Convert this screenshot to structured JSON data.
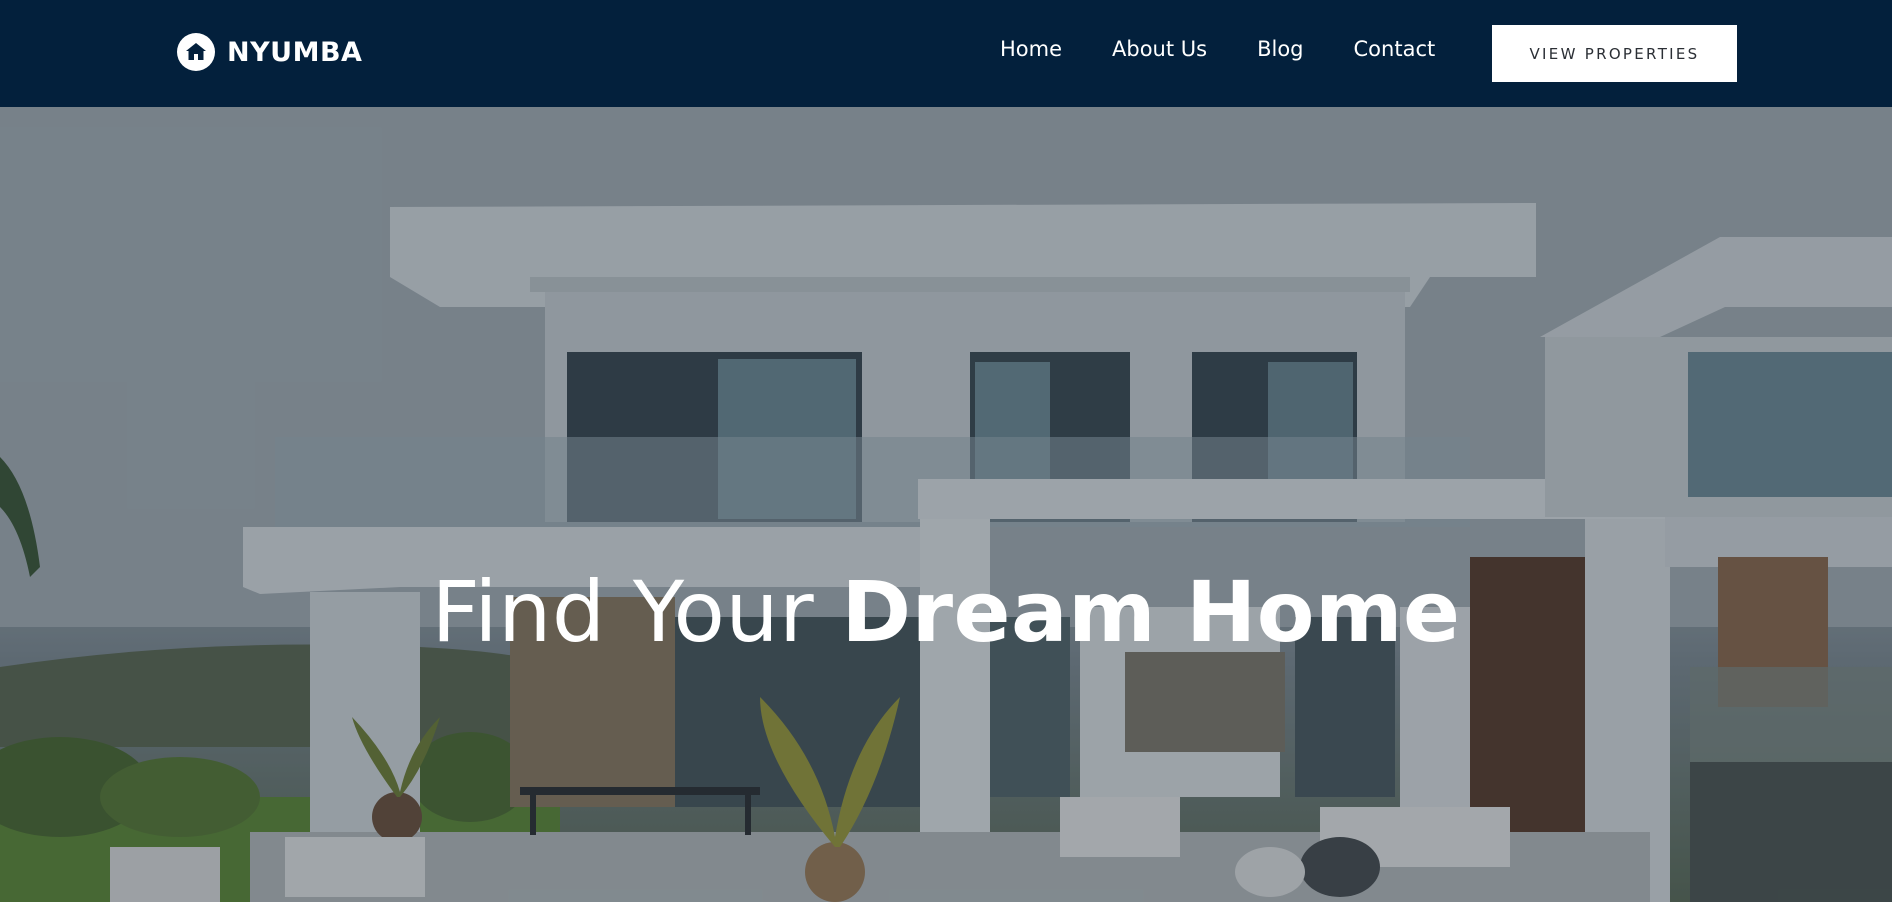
{
  "brand": {
    "name": "NYUMBA",
    "icon": "home-icon"
  },
  "nav": {
    "items": [
      {
        "label": "Home"
      },
      {
        "label": "About Us"
      },
      {
        "label": "Blog"
      },
      {
        "label": "Contact"
      }
    ],
    "cta_label": "VIEW PROPERTIES"
  },
  "hero": {
    "headline_light": "Find Your ",
    "headline_bold": "Dream Home"
  },
  "colors": {
    "header_bg": "#03203c",
    "cta_bg": "#ffffff",
    "headline": "#ffffff"
  }
}
